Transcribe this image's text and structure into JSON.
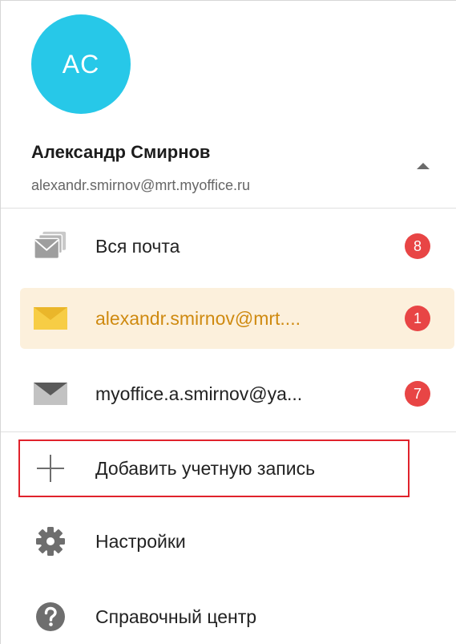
{
  "account": {
    "avatar_initials": "AC",
    "avatar_color": "#27c8e8",
    "name": "Александр Смирнов",
    "email": "alexandr.smirnov@mrt.myoffice.ru",
    "toggle_icon": "chevron-up-icon"
  },
  "mailboxes": [
    {
      "label": "Вся почта",
      "icon": "all-mail-icon",
      "count": "8",
      "active": false
    },
    {
      "label": "alexandr.smirnov@mrt....",
      "icon": "envelope-icon",
      "count": "1",
      "active": true
    },
    {
      "label": "myoffice.a.smirnov@ya...",
      "icon": "envelope-icon",
      "count": "7",
      "active": false
    }
  ],
  "actions": {
    "add_account": {
      "label": "Добавить учетную запись",
      "icon": "plus-icon"
    },
    "settings": {
      "label": "Настройки",
      "icon": "gear-icon"
    },
    "help": {
      "label": "Справочный центр",
      "icon": "help-icon"
    }
  },
  "colors": {
    "accent": "#cf8a10",
    "active_background": "#fcf0dc",
    "badge": "#e84545",
    "highlight_frame": "#e0222c"
  }
}
